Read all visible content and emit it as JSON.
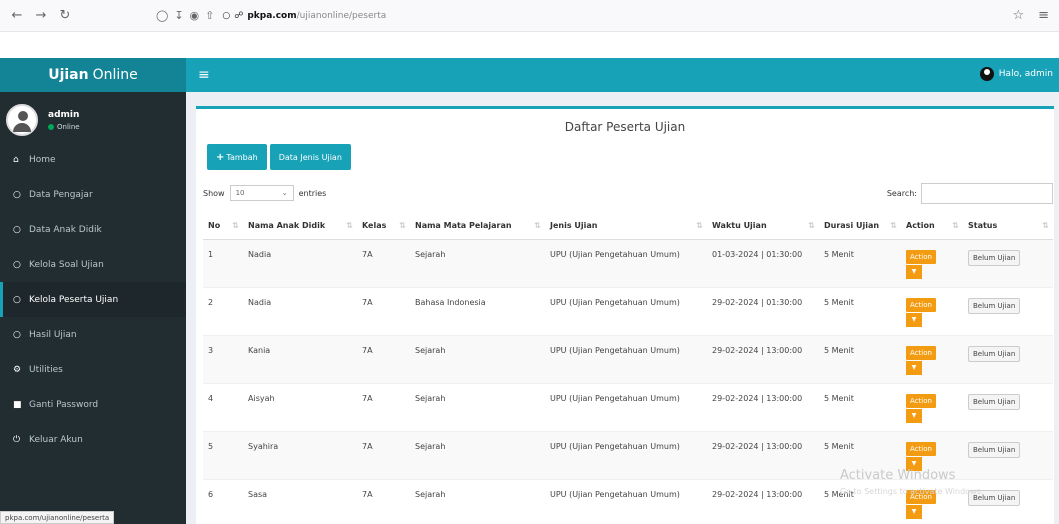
{
  "browser": {
    "host": "pkpa.com",
    "path": "/ujianonline/peserta",
    "status_url": "pkpa.com/ujianonline/peserta"
  },
  "header": {
    "brand_bold": "Ujian",
    "brand_rest": "Online",
    "user_greeting": "Halo, admin"
  },
  "sidebar": {
    "user_name": "admin",
    "user_status": "Online",
    "items": [
      {
        "label": "Home",
        "icon": "home-icon"
      },
      {
        "label": "Data Pengajar",
        "icon": "circle-icon"
      },
      {
        "label": "Data Anak Didik",
        "icon": "circle-icon"
      },
      {
        "label": "Kelola Soal Ujian",
        "icon": "circle-icon"
      },
      {
        "label": "Kelola Peserta Ujian",
        "icon": "circle-icon"
      },
      {
        "label": "Hasil Ujian",
        "icon": "circle-icon"
      },
      {
        "label": "Utilities",
        "icon": "gears-icon"
      },
      {
        "label": "Ganti Password",
        "icon": "lock-icon"
      },
      {
        "label": "Keluar Akun",
        "icon": "power-icon"
      }
    ]
  },
  "main": {
    "title": "Daftar Peserta Ujian",
    "btn_tambah": "Tambah",
    "btn_jenis": "Data Jenis Ujian",
    "show_label": "Show",
    "entries_value": "10",
    "entries_label": "entries",
    "search_label": "Search:",
    "columns": [
      "No",
      "Nama Anak Didik",
      "Kelas",
      "Nama Mata Pelajaran",
      "Jenis Ujian",
      "Waktu Ujian",
      "Durasi Ujian",
      "Action",
      "Status"
    ],
    "action_label": "Action",
    "rows": [
      {
        "no": "1",
        "nama": "Nadia",
        "kelas": "7A",
        "mapel": "Sejarah",
        "jenis": "UPU (Ujian Pengetahuan Umum)",
        "waktu": "01-03-2024 | 01:30:00",
        "durasi": "5 Menit",
        "status": "Belum Ujian"
      },
      {
        "no": "2",
        "nama": "Nadia",
        "kelas": "7A",
        "mapel": "Bahasa Indonesia",
        "jenis": "UPU (Ujian Pengetahuan Umum)",
        "waktu": "29-02-2024 | 01:30:00",
        "durasi": "5 Menit",
        "status": "Belum Ujian"
      },
      {
        "no": "3",
        "nama": "Kania",
        "kelas": "7A",
        "mapel": "Sejarah",
        "jenis": "UPU (Ujian Pengetahuan Umum)",
        "waktu": "29-02-2024 | 13:00:00",
        "durasi": "5 Menit",
        "status": "Belum Ujian"
      },
      {
        "no": "4",
        "nama": "Aisyah",
        "kelas": "7A",
        "mapel": "Sejarah",
        "jenis": "UPU (Ujian Pengetahuan Umum)",
        "waktu": "29-02-2024 | 13:00:00",
        "durasi": "5 Menit",
        "status": "Belum Ujian"
      },
      {
        "no": "5",
        "nama": "Syahira",
        "kelas": "7A",
        "mapel": "Sejarah",
        "jenis": "UPU (Ujian Pengetahuan Umum)",
        "waktu": "29-02-2024 | 13:00:00",
        "durasi": "5 Menit",
        "status": "Belum Ujian"
      },
      {
        "no": "6",
        "nama": "Sasa",
        "kelas": "7A",
        "mapel": "Sejarah",
        "jenis": "UPU (Ujian Pengetahuan Umum)",
        "waktu": "29-02-2024 | 13:00:00",
        "durasi": "5 Menit",
        "status": "Belum Ujian"
      }
    ]
  },
  "watermark": {
    "line1": "Activate Windows",
    "line2": "Go to Settings to activate Windows."
  },
  "colors": {
    "accent": "#17a2b8",
    "sidebar_bg": "#222d32",
    "action": "#f39c12"
  }
}
